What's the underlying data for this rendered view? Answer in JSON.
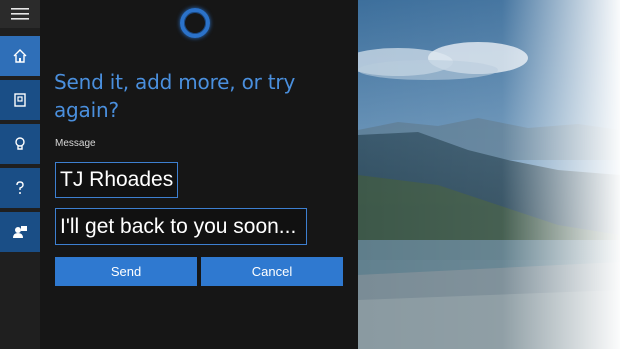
{
  "cortana": {
    "prompt": "Send it, add more, or try again?",
    "message_label": "Message",
    "recipient": "TJ Rhoades",
    "message_text": "I'll get back to you soon...",
    "send_label": "Send",
    "cancel_label": "Cancel"
  },
  "nav": {
    "items": [
      {
        "name": "home-icon",
        "glyph": "home"
      },
      {
        "name": "notebook-icon",
        "glyph": "notebook"
      },
      {
        "name": "reminders-icon",
        "glyph": "lightbulb"
      },
      {
        "name": "help-icon",
        "glyph": "?"
      },
      {
        "name": "feedback-icon",
        "glyph": "people"
      }
    ]
  },
  "colors": {
    "accent": "#2f79d0",
    "prompt_text": "#4a8fdd",
    "panel": "#161616",
    "rail": "#1a4e86"
  }
}
